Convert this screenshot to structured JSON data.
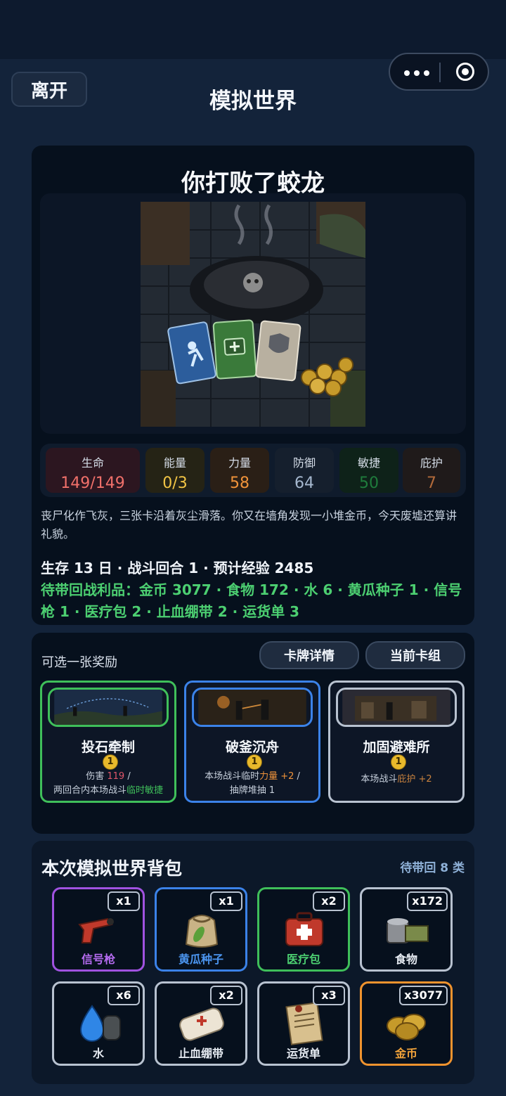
{
  "header": {
    "leave_label": "离开",
    "title": "模拟世界"
  },
  "event": {
    "title": "你打败了蛟龙",
    "stats": [
      {
        "label": "生命",
        "value": "149/149",
        "color": "#f0706a",
        "bg": "#2c1620"
      },
      {
        "label": "能量",
        "value": "0/3",
        "color": "#f2c545",
        "bg": "#252315"
      },
      {
        "label": "力量",
        "value": "58",
        "color": "#f0933a",
        "bg": "#2a1f16"
      },
      {
        "label": "防御",
        "value": "64",
        "color": "#a6b8cf",
        "bg": "#151f2d"
      },
      {
        "label": "敏捷",
        "value": "50",
        "color": "#1f7c3c",
        "bg": "#0e2219"
      },
      {
        "label": "庇护",
        "value": "7",
        "color": "#b26a3a",
        "bg": "#1f1a1a"
      }
    ],
    "description": "丧尸化作飞灰，三张卡沿着灰尘滑落。你又在墙角发现一小堆金币，今天废墟还算讲礼貌。",
    "summary": "生存 13 日 · 战斗回合 1 · 预计经验 2485",
    "loot": "待带回战利品：金币 3077 · 食物 172 · 水 6 · 黄瓜种子 1 · 信号枪 1 · 医疗包 2 · 止血绷带 2 · 运货单 3"
  },
  "reward": {
    "title": "可选一张奖励",
    "card_detail_label": "卡牌详情",
    "current_deck_label": "当前卡组",
    "cards": [
      {
        "name": "投石牵制",
        "cost": "1",
        "border": "#3fbf5a",
        "lines": [
          [
            {
              "t": "伤害 "
            },
            {
              "t": "119",
              "c": "#e0566a"
            },
            {
              "t": " /"
            }
          ],
          [
            {
              "t": "两回合内本场战斗"
            },
            {
              "t": "临时敏捷",
              "c": "#3fbf5a"
            }
          ]
        ]
      },
      {
        "name": "破釜沉舟",
        "cost": "1",
        "border": "#3b82e8",
        "lines": [
          [
            {
              "t": "本场战斗临时"
            },
            {
              "t": "力量 +2",
              "c": "#f0933a"
            },
            {
              "t": " /"
            }
          ],
          [
            {
              "t": "抽牌堆抽 1"
            }
          ]
        ]
      },
      {
        "name": "加固避难所",
        "cost": "1",
        "border": "#b8c2d0",
        "lines": [
          [
            {
              "t": "本场战斗"
            },
            {
              "t": "庇护 +2",
              "c": "#c9823e"
            }
          ]
        ]
      }
    ]
  },
  "bag": {
    "title": "本次模拟世界背包",
    "count_label": "待带回 8 类",
    "items": [
      {
        "name": "信号枪",
        "qty": "x1",
        "border": "#a052e0",
        "name_color": "#b66cf2",
        "icon": "flare-gun-icon"
      },
      {
        "name": "黄瓜种子",
        "qty": "x1",
        "border": "#3b82e8",
        "name_color": "#4b95ef",
        "icon": "seed-bag-icon"
      },
      {
        "name": "医疗包",
        "qty": "x2",
        "border": "#3fbf5a",
        "name_color": "#4ccf71",
        "icon": "medkit-icon"
      },
      {
        "name": "食物",
        "qty": "x172",
        "border": "#b8c2d0",
        "name_color": "#e6ebf2",
        "icon": "canned-food-icon"
      },
      {
        "name": "水",
        "qty": "x6",
        "border": "#b8c2d0",
        "name_color": "#e6ebf2",
        "icon": "water-icon"
      },
      {
        "name": "止血绷带",
        "qty": "x2",
        "border": "#b8c2d0",
        "name_color": "#e6ebf2",
        "icon": "bandage-icon"
      },
      {
        "name": "运货单",
        "qty": "x3",
        "border": "#b8c2d0",
        "name_color": "#e6ebf2",
        "icon": "shipping-note-icon"
      },
      {
        "name": "金币",
        "qty": "x3077",
        "border": "#f0932e",
        "name_color": "#f0a23a",
        "icon": "gold-coins-icon"
      }
    ]
  }
}
